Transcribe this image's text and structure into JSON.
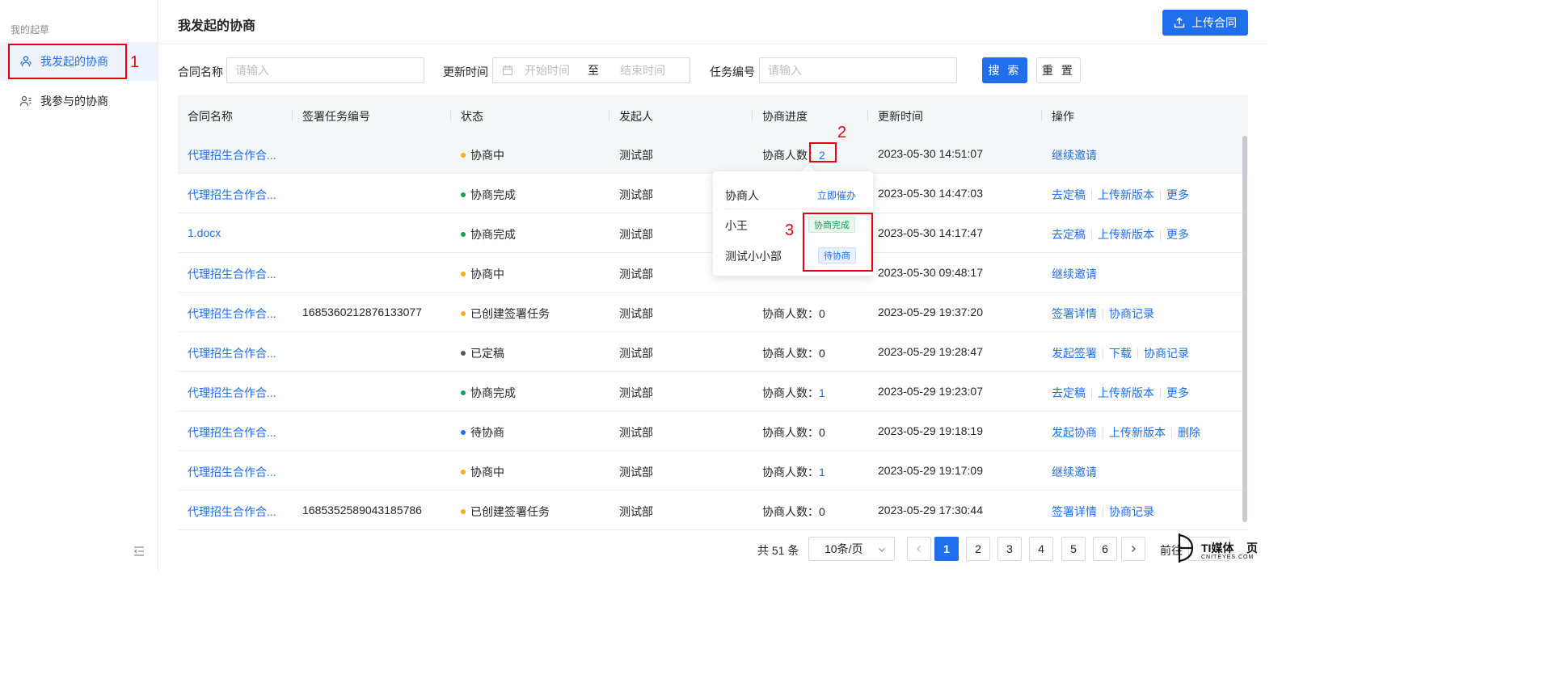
{
  "sidebar": {
    "section_title": "我的起草",
    "items": [
      {
        "label": "我发起的协商",
        "icon": "users-icon",
        "active": true
      },
      {
        "label": "我参与的协商",
        "icon": "user-list-icon",
        "active": false
      }
    ]
  },
  "header": {
    "title": "我发起的协商",
    "upload_label": "上传合同",
    "upload_icon": "upload-icon"
  },
  "filters": {
    "contract_name_label": "合同名称",
    "contract_name_placeholder": "请输入",
    "update_time_label": "更新时间",
    "start_placeholder": "开始时间",
    "range_separator": "至",
    "end_placeholder": "结束时间",
    "task_no_label": "任务编号",
    "task_no_placeholder": "请输入",
    "search_label": "搜 索",
    "reset_label": "重 置"
  },
  "table": {
    "columns": [
      "合同名称",
      "签署任务编号",
      "状态",
      "发起人",
      "协商进度",
      "更新时间",
      "操作"
    ],
    "progress_prefix": "协商人数：",
    "rows": [
      {
        "name": "代理招生合作合...",
        "task_no": "",
        "status": "协商中",
        "status_color": "#faad14",
        "initiator": "测试部",
        "count": "2",
        "count_link": true,
        "updated": "2023-05-30 14:51:07",
        "ops": [
          "继续邀请"
        ]
      },
      {
        "name": "代理招生合作合...",
        "task_no": "",
        "status": "协商完成",
        "status_color": "#17a05d",
        "initiator": "测试部",
        "count": "",
        "count_link": false,
        "updated": "2023-05-30 14:47:03",
        "ops": [
          "去定稿",
          "上传新版本",
          "更多"
        ]
      },
      {
        "name": "1.docx",
        "task_no": "",
        "status": "协商完成",
        "status_color": "#17a05d",
        "initiator": "测试部",
        "count": "",
        "count_link": false,
        "updated": "2023-05-30 14:17:47",
        "ops": [
          "去定稿",
          "上传新版本",
          "更多"
        ]
      },
      {
        "name": "代理招生合作合...",
        "task_no": "",
        "status": "协商中",
        "status_color": "#faad14",
        "initiator": "测试部",
        "count": "",
        "count_link": false,
        "updated": "2023-05-30 09:48:17",
        "ops": [
          "继续邀请"
        ]
      },
      {
        "name": "代理招生合作合...",
        "task_no": "1685360212876133077",
        "status": "已创建签署任务",
        "status_color": "#faad14",
        "initiator": "测试部",
        "count": "0",
        "count_link": false,
        "updated": "2023-05-29 19:37:20",
        "ops": [
          "签署详情",
          "协商记录"
        ]
      },
      {
        "name": "代理招生合作合...",
        "task_no": "",
        "status": "已定稿",
        "status_color": "#595959",
        "initiator": "测试部",
        "count": "0",
        "count_link": false,
        "updated": "2023-05-29 19:28:47",
        "ops": [
          "发起签署",
          "下载",
          "协商记录"
        ]
      },
      {
        "name": "代理招生合作合...",
        "task_no": "",
        "status": "协商完成",
        "status_color": "#17a05d",
        "initiator": "测试部",
        "count": "1",
        "count_link": true,
        "updated": "2023-05-29 19:23:07",
        "ops": [
          "去定稿",
          "上传新版本",
          "更多"
        ]
      },
      {
        "name": "代理招生合作合...",
        "task_no": "",
        "status": "待协商",
        "status_color": "#1f6feb",
        "initiator": "测试部",
        "count": "0",
        "count_link": false,
        "updated": "2023-05-29 19:18:19",
        "ops": [
          "发起协商",
          "上传新版本",
          "删除"
        ]
      },
      {
        "name": "代理招生合作合...",
        "task_no": "",
        "status": "协商中",
        "status_color": "#faad14",
        "initiator": "测试部",
        "count": "1",
        "count_link": true,
        "updated": "2023-05-29 19:17:09",
        "ops": [
          "继续邀请"
        ]
      },
      {
        "name": "代理招生合作合...",
        "task_no": "1685352589043185786",
        "status": "已创建签署任务",
        "status_color": "#faad14",
        "initiator": "测试部",
        "count": "0",
        "count_link": false,
        "updated": "2023-05-29 17:30:44",
        "ops": [
          "签署详情",
          "协商记录"
        ]
      }
    ]
  },
  "popover": {
    "header_label": "协商人",
    "urge_label": "立即催办",
    "participants": [
      {
        "name": "小王",
        "status": "协商完成",
        "kind": "done"
      },
      {
        "name": "测试小小部",
        "status": "待协商",
        "kind": "pending"
      }
    ]
  },
  "annotations": [
    "1",
    "2",
    "3"
  ],
  "pagination": {
    "total_label": "共 51 条",
    "page_size": "10条/页",
    "pages": [
      "1",
      "2",
      "3",
      "4",
      "5",
      "6"
    ],
    "current": "1",
    "goto_label": "前往"
  },
  "watermark": {
    "text": "TI媒体",
    "suffix": "页",
    "sub": "CNITEYES.COM"
  }
}
